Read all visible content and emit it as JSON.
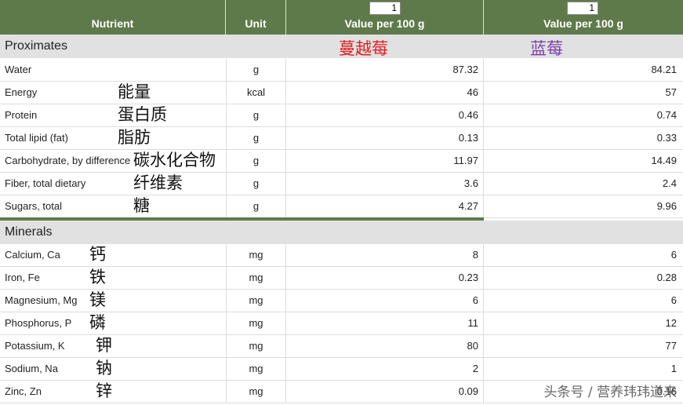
{
  "header": {
    "nutrient": "Nutrient",
    "unit": "Unit",
    "col1_qty": "1",
    "col1_label": "Value per 100 g",
    "col2_qty": "1",
    "col2_label": "Value per 100 g"
  },
  "fruits": {
    "col1": "蔓越莓",
    "col2": "蓝莓",
    "col1_color": "#e02020",
    "col2_color": "#7a3fb0"
  },
  "sections": {
    "proximates": "Proximates",
    "minerals": "Minerals"
  },
  "proximates": [
    {
      "name": "Water",
      "zh": "",
      "unit": "g",
      "v1": "87.32",
      "v2": "84.21"
    },
    {
      "name": "Energy",
      "zh": "能量",
      "unit": "kcal",
      "v1": "46",
      "v2": "57"
    },
    {
      "name": "Protein",
      "zh": "蛋白质",
      "unit": "g",
      "v1": "0.46",
      "v2": "0.74"
    },
    {
      "name": "Total lipid (fat)",
      "zh": "脂肪",
      "unit": "g",
      "v1": "0.13",
      "v2": "0.33"
    },
    {
      "name": "Carbohydrate, by difference",
      "zh": "碳水化合物",
      "unit": "g",
      "v1": "11.97",
      "v2": "14.49"
    },
    {
      "name": "Fiber, total dietary",
      "zh": "纤维素",
      "unit": "g",
      "v1": "3.6",
      "v2": "2.4"
    },
    {
      "name": "Sugars, total",
      "zh": "糖",
      "unit": "g",
      "v1": "4.27",
      "v2": "9.96"
    }
  ],
  "minerals": [
    {
      "name": "Calcium, Ca",
      "zh": "钙",
      "unit": "mg",
      "v1": "8",
      "v2": "6"
    },
    {
      "name": "Iron, Fe",
      "zh": "铁",
      "unit": "mg",
      "v1": "0.23",
      "v2": "0.28"
    },
    {
      "name": "Magnesium, Mg",
      "zh": "镁",
      "unit": "mg",
      "v1": "6",
      "v2": "6"
    },
    {
      "name": "Phosphorus, P",
      "zh": "磷",
      "unit": "mg",
      "v1": "11",
      "v2": "12"
    },
    {
      "name": "Potassium, K",
      "zh": "钾",
      "unit": "mg",
      "v1": "80",
      "v2": "77"
    },
    {
      "name": "Sodium, Na",
      "zh": "钠",
      "unit": "mg",
      "v1": "2",
      "v2": "1"
    },
    {
      "name": "Zinc, Zn",
      "zh": "锌",
      "unit": "mg",
      "v1": "0.09",
      "v2": "0.16"
    }
  ],
  "watermark": "头条号 / 营养玮玮道来"
}
